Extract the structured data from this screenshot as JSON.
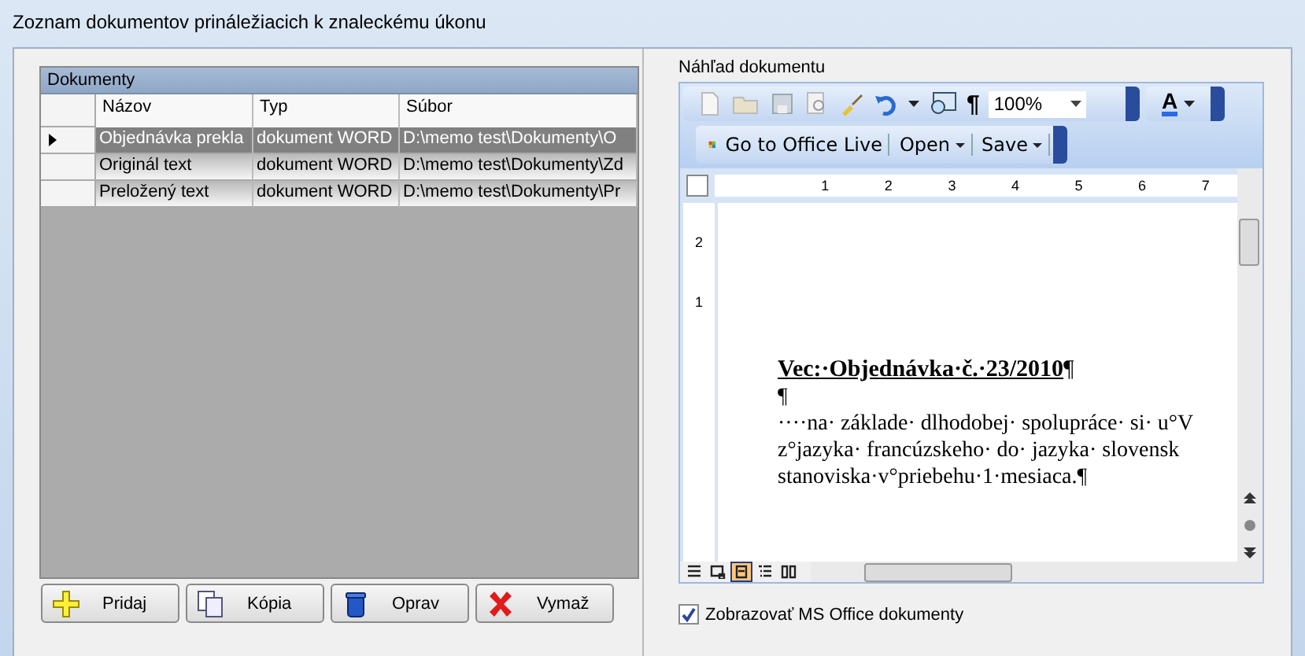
{
  "window": {
    "title": "Zoznam dokumentov prináležiacich k znaleckému úkonu"
  },
  "documents": {
    "caption": "Dokumenty",
    "columns": [
      "Názov",
      "Typ",
      "Súbor"
    ],
    "rows": [
      {
        "cells": [
          "Objednávka prekla",
          "dokument WORD",
          "D:\\memo test\\Dokumenty\\O"
        ],
        "selected": true
      },
      {
        "cells": [
          "Originál text",
          "dokument WORD",
          "D:\\memo test\\Dokumenty\\Zd"
        ],
        "selected": false
      },
      {
        "cells": [
          "Preložený text",
          "dokument WORD",
          "D:\\memo test\\Dokumenty\\Pr"
        ],
        "selected": false
      }
    ]
  },
  "buttons": [
    {
      "label": "Pridaj",
      "kind": "add"
    },
    {
      "label": "Kópia",
      "kind": "copy"
    },
    {
      "label": "Oprav",
      "kind": "edit"
    },
    {
      "label": "Vymaž",
      "kind": "delete"
    }
  ],
  "preview": {
    "title": "Náhľad dokumentu",
    "toolbar": {
      "pilcrow": "¶",
      "zoom": "100%",
      "font_color": "A",
      "office_live": "Go to Office Live",
      "open": "Open",
      "save": "Save"
    },
    "ruler": [
      "1",
      "2",
      "3",
      "4",
      "5",
      "6",
      "7"
    ],
    "vertical_ruler": [
      "2",
      "1"
    ],
    "document": {
      "heading": "Vec:·Objednávka·č.·23/2010",
      "heading_mark": "¶",
      "lines": [
        "¶",
        "····na· základe· dlhodobej· spolupráce· si· u°V",
        "z°jazyka· francúzskeho· do· jazyka· slovensk",
        "stanoviska·v°priebehu·1·mesiaca.¶"
      ]
    },
    "view_buttons": [
      {
        "kind": "normal",
        "selected": false
      },
      {
        "kind": "web",
        "selected": false
      },
      {
        "kind": "print",
        "selected": true
      },
      {
        "kind": "outline",
        "selected": false
      },
      {
        "kind": "reading",
        "selected": false
      }
    ]
  },
  "show_office": {
    "label": "Zobrazovať MS Office dokumenty",
    "checked": true
  }
}
